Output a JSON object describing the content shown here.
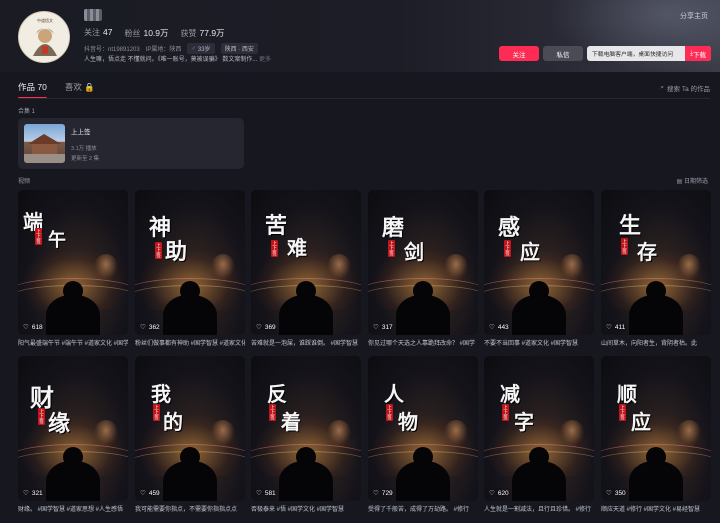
{
  "profile": {
    "avatar_text": "中道悟文",
    "stats": [
      {
        "label": "关注",
        "value": "47"
      },
      {
        "label": "粉丝",
        "value": "10.9万"
      },
      {
        "label": "获赞",
        "value": "77.9万"
      }
    ],
    "account_id": "抖音号：nt19891203",
    "ip": "IP属地：陕西",
    "age_chip": "33岁",
    "location_chip": "陕西 · 西安",
    "bio": "人生嘛，悟点走 不懂就问。《唯一账号，莫被误骗》 数文案制作...",
    "bio_more": "更多",
    "share_label": "分享主页",
    "follow_label": "关注",
    "message_label": "私信",
    "download_text": "下载电脑客户端，桌面快捷访问",
    "download_icon": "下载"
  },
  "tabs": {
    "works_label": "作品",
    "works_count": "70",
    "likes_label": "喜欢",
    "search_label": "搜索 Ta 的作品"
  },
  "collection": {
    "section_label": "合集 1",
    "title": "上上签",
    "plays": "3.1万 播放",
    "updated": "更新至 2 集"
  },
  "videos": {
    "section_label": "视频",
    "filter_label": "日期筛选",
    "items": [
      {
        "title": "端午",
        "seal": "上上签",
        "likes": "618",
        "caption": "阳气最盛端午节 #端午节 #道家文化 #国学智慧"
      },
      {
        "title": "神助",
        "seal": "上上签",
        "likes": "362",
        "caption": "粉丝们做事都有神助 #国学智慧 #道家文化"
      },
      {
        "title": "苦难",
        "seal": "上上签",
        "likes": "369",
        "caption": "苦难就是一泡屎，谁踩谁倒。 #国学智慧"
      },
      {
        "title": "磨剑",
        "seal": "上上签",
        "likes": "317",
        "caption": "你见过哪个天选之人靠跪拜改命？ #国学"
      },
      {
        "title": "感应",
        "seal": "上上签",
        "likes": "443",
        "caption": "不要不当回事 #道家文化 #国学智慧"
      },
      {
        "title": "生存",
        "seal": "上上签",
        "likes": "411",
        "caption": "山间草木，向阳者生，背阴者枯。此"
      },
      {
        "title": "财缘",
        "seal": "上上签",
        "likes": "321",
        "caption": "财缘。 #国学智慧 #道家思想 #人生感悟"
      },
      {
        "title": "我的",
        "seal": "上上签",
        "likes": "459",
        "caption": "我可能需要你指点，不需要你指指点点"
      },
      {
        "title": "反着",
        "seal": "上上签",
        "likes": "581",
        "caption": "否极泰来 #悟 #国学文化 #国学智慧"
      },
      {
        "title": "人物",
        "seal": "上上签",
        "likes": "729",
        "caption": "受得了千般苦，成得了万劫路。 #修行"
      },
      {
        "title": "减字",
        "seal": "上上签",
        "likes": "620",
        "caption": "人生就是一割减法，且行且珍惜。 #修行"
      },
      {
        "title": "顺应",
        "seal": "上上签",
        "likes": "350",
        "caption": "顺应天道 #修行 #国学文化 #易经智慧"
      }
    ]
  },
  "colors": {
    "accent": "#fe2c55",
    "background": "#16171f",
    "card": "#25262f"
  }
}
